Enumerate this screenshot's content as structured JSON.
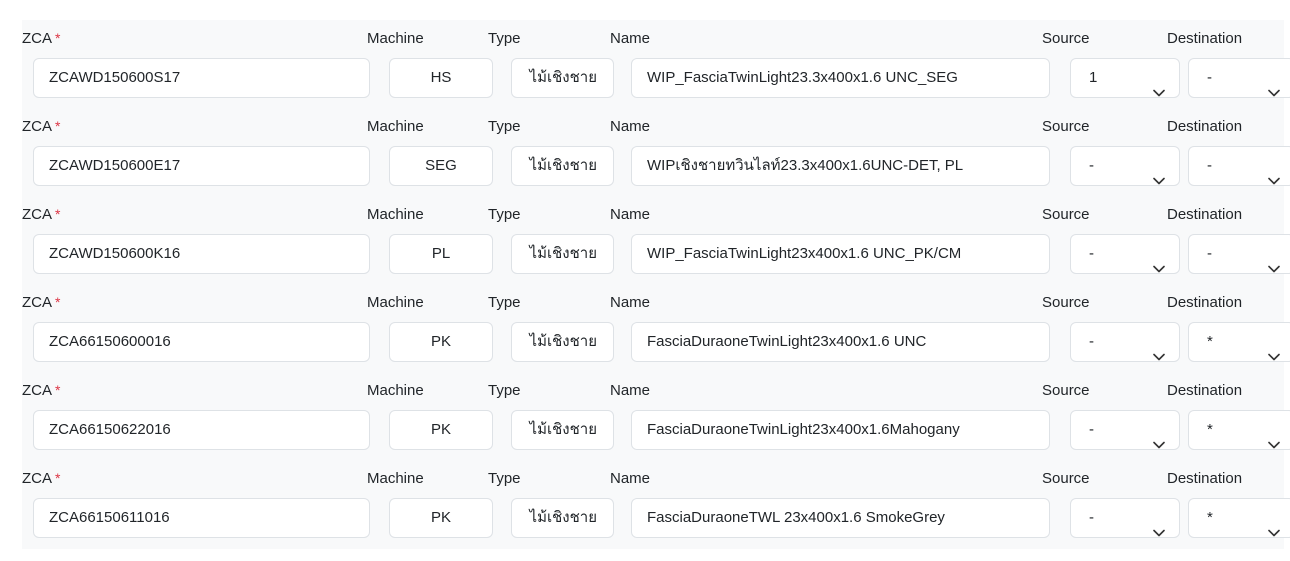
{
  "labels": {
    "zca": "ZCA",
    "required_mark": "*",
    "machine": "Machine",
    "type": "Type",
    "name": "Name",
    "source": "Source",
    "destination": "Destination"
  },
  "colors": {
    "required": "#dc3545",
    "panel_background": "#f8f9fa",
    "field_border": "#dee2e6"
  },
  "rows": [
    {
      "zca": "ZCAWD150600S17",
      "machine": "HS",
      "type": "ไม้เชิงชาย",
      "name": "WIP_FasciaTwinLight23.3x400x1.6 UNC_SEG",
      "source": "1",
      "destination": "-"
    },
    {
      "zca": "ZCAWD150600E17",
      "machine": "SEG",
      "type": "ไม้เชิงชาย",
      "name": "WIPเชิงชายทวินไลท์23.3x400x1.6UNC-DET, PL",
      "source": "-",
      "destination": "-"
    },
    {
      "zca": "ZCAWD150600K16",
      "machine": "PL",
      "type": "ไม้เชิงชาย",
      "name": "WIP_FasciaTwinLight23x400x1.6 UNC_PK/CM",
      "source": "-",
      "destination": "-"
    },
    {
      "zca": "ZCA66150600016",
      "machine": "PK",
      "type": "ไม้เชิงชาย",
      "name": "FasciaDuraoneTwinLight23x400x1.6 UNC",
      "source": "-",
      "destination": "*"
    },
    {
      "zca": "ZCA66150622016",
      "machine": "PK",
      "type": "ไม้เชิงชาย",
      "name": "FasciaDuraoneTwinLight23x400x1.6Mahogany",
      "source": "-",
      "destination": "*"
    },
    {
      "zca": "ZCA66150611016",
      "machine": "PK",
      "type": "ไม้เชิงชาย",
      "name": "FasciaDuraoneTWL 23x400x1.6 SmokeGrey",
      "source": "-",
      "destination": "*"
    }
  ]
}
